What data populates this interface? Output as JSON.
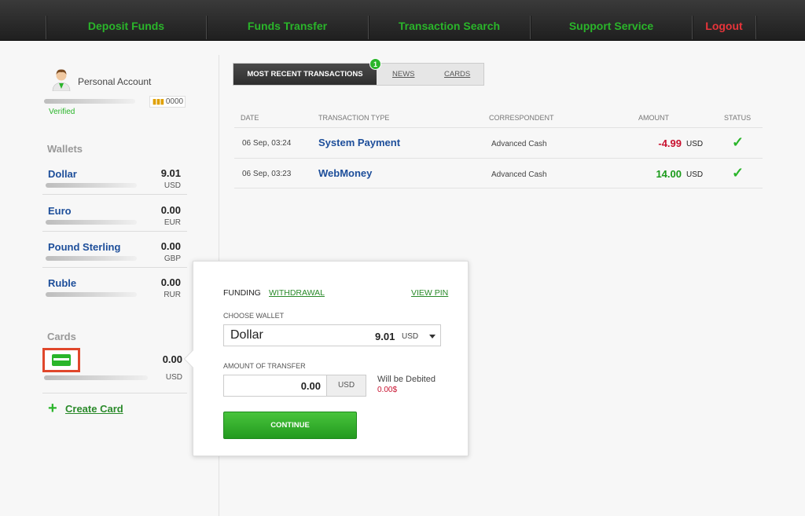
{
  "nav": {
    "items": [
      {
        "label": "Deposit Funds"
      },
      {
        "label": "Funds Transfer"
      },
      {
        "label": "Transaction Search"
      },
      {
        "label": "Support Service"
      },
      {
        "label": "Logout"
      }
    ]
  },
  "account": {
    "name": "Personal Account",
    "rating": "0000",
    "status": "Verified"
  },
  "wallets": {
    "title": "Wallets",
    "items": [
      {
        "name": "Dollar",
        "amount": "9.01",
        "currency": "USD"
      },
      {
        "name": "Euro",
        "amount": "0.00",
        "currency": "EUR"
      },
      {
        "name": "Pound Sterling",
        "amount": "0.00",
        "currency": "GBP"
      },
      {
        "name": "Ruble",
        "amount": "0.00",
        "currency": "RUR"
      }
    ]
  },
  "cards": {
    "title": "Cards",
    "amount": "0.00",
    "currency": "USD",
    "create_label": "Create Card"
  },
  "tabs": {
    "active": "MOST RECENT TRANSACTIONS",
    "badge": "1",
    "news": "NEWS",
    "cards": "CARDS"
  },
  "transactions": {
    "headers": {
      "date": "DATE",
      "type": "TRANSACTION TYPE",
      "correspondent": "CORRESPONDENT",
      "amount": "AMOUNT",
      "status": "STATUS"
    },
    "rows": [
      {
        "date": "06 Sep, 03:24",
        "type": "System Payment",
        "correspondent": "Advanced Cash",
        "amount": "-4.99",
        "currency": "USD",
        "status": "✓"
      },
      {
        "date": "06 Sep, 03:23",
        "type": "WebMoney",
        "correspondent": "Advanced Cash",
        "amount": "14.00",
        "currency": "USD",
        "status": "✓"
      }
    ]
  },
  "popup": {
    "funding": "FUNDING",
    "withdrawal": "WITHDRAWAL",
    "view_pin": "VIEW PIN",
    "choose_wallet_label": "CHOOSE WALLET",
    "selected_wallet": {
      "name": "Dollar",
      "amount": "9.01",
      "currency": "USD"
    },
    "amount_label": "AMOUNT OF TRANSFER",
    "amount_value": "0.00",
    "amount_currency": "USD",
    "debit_label": "Will be Debited",
    "debit_amount": "0.00$",
    "continue_label": "CONTINUE"
  },
  "colors": {
    "accent": "#2ab52a",
    "logout": "#e8343a",
    "link": "#1d4e9a",
    "negative": "#c8102e"
  }
}
